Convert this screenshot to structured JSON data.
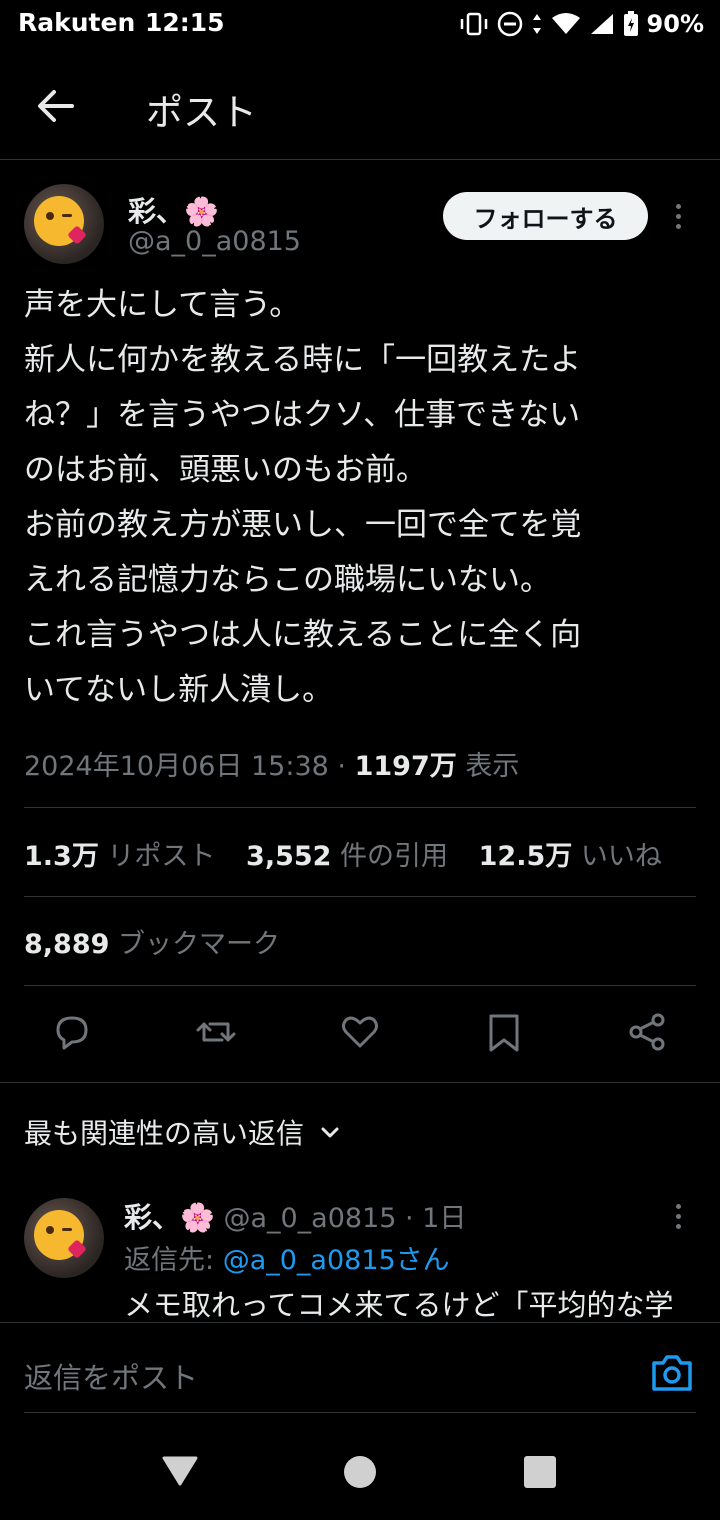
{
  "status_bar": {
    "carrier": "Rakuten",
    "time": "12:15",
    "battery": "90%"
  },
  "header": {
    "title": "ポスト"
  },
  "post": {
    "author_name": "彩、🌸",
    "author_handle": "@a_0_a0815",
    "follow_label": "フォローする",
    "text_lines": [
      "声を大にして言う。",
      "新人に何かを教える時に「一回教えたよ",
      "ね？」を言うやつはクソ、仕事できない",
      "のはお前、頭悪いのもお前。",
      "お前の教え方が悪いし、一回で全てを覚",
      "えれる記憶力ならこの職場にいない。",
      "これ言うやつは人に教えることに全く向",
      "いてないし新人潰し。"
    ],
    "timestamp": "2024年10月06日 15:38 · ",
    "views_count": "1197万",
    "views_label": " 表示",
    "reposts_count": "1.3万",
    "reposts_label": " リポスト",
    "quotes_count": "3,552",
    "quotes_label": " 件の引用",
    "likes_count": "12.5万",
    "likes_label": " いいね",
    "bookmarks_count": "8,889",
    "bookmarks_label": " ブックマーク"
  },
  "actions": [
    "reply-icon",
    "repost-icon",
    "like-icon",
    "bookmark-icon",
    "share-icon"
  ],
  "replies": {
    "sort_label": "最も関連性の高い返信",
    "items": [
      {
        "author_name": "彩、🌸",
        "handle_time": " @a_0_a0815 · 1日",
        "replying_prefix": "返信先: ",
        "replying_to": "@a_0_a0815さん",
        "text": "メモ取れってコメ来てるけど「平均的な学"
      }
    ]
  },
  "compose": {
    "placeholder": "返信をポスト"
  },
  "colors": {
    "background": "#000000",
    "text": "#e7e9ea",
    "muted": "#71767b",
    "accent": "#1d9bf0",
    "divider": "#2f3336"
  }
}
